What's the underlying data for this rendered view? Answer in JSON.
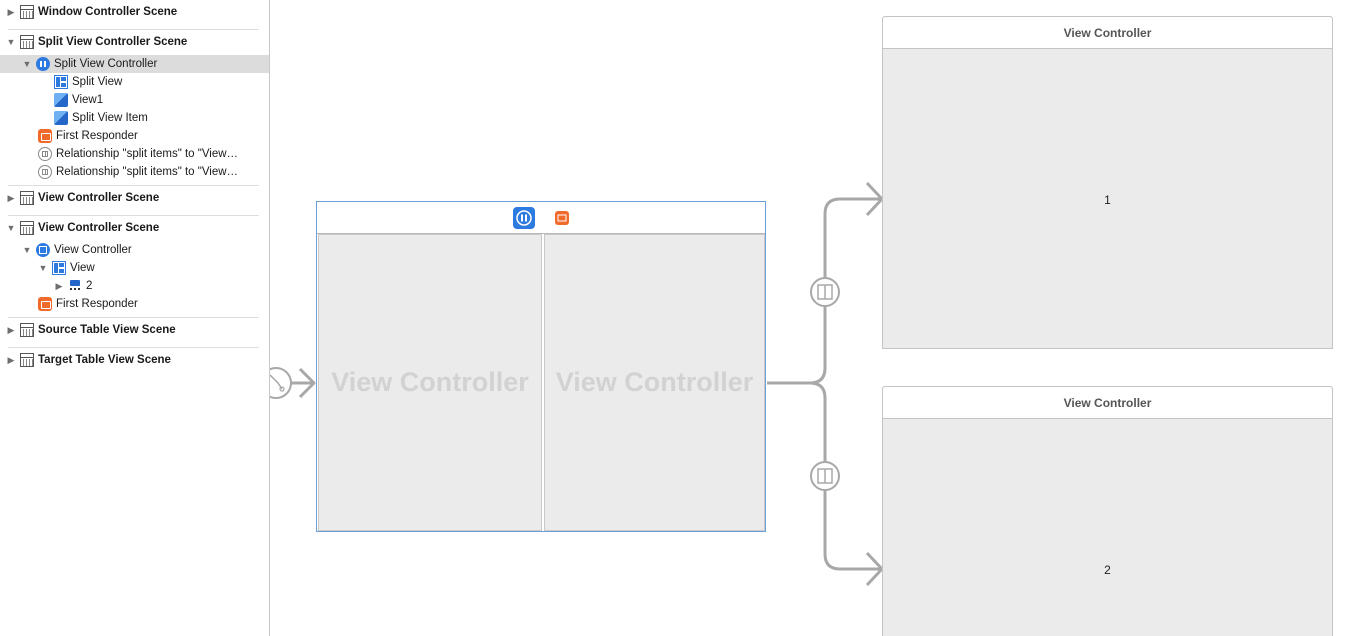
{
  "outline": {
    "rows": [
      {
        "label": "Window Controller Scene"
      },
      {
        "label": "Split View Controller Scene"
      },
      {
        "label": "Split View Controller"
      },
      {
        "label": "Split View"
      },
      {
        "label": "View1"
      },
      {
        "label": "Split View Item"
      },
      {
        "label": "First Responder"
      },
      {
        "label": "Relationship \"split items\" to \"View…"
      },
      {
        "label": "Relationship \"split items\" to \"View…"
      },
      {
        "label": "View Controller Scene"
      },
      {
        "label": "View Controller Scene"
      },
      {
        "label": "View Controller"
      },
      {
        "label": "View"
      },
      {
        "label": "2"
      },
      {
        "label": "First Responder"
      },
      {
        "label": "Source Table View Scene"
      },
      {
        "label": "Target Table View Scene"
      }
    ]
  },
  "canvas": {
    "split_controller": {
      "left_pane_title": "View Controller",
      "right_pane_title": "View Controller"
    },
    "view_controller_1": {
      "title": "View Controller",
      "content": "1"
    },
    "view_controller_2": {
      "title": "View Controller",
      "content": "2"
    }
  },
  "colors": {
    "accent": "#2d7be0",
    "first_responder": "#f06a2b",
    "segue_line": "#a8a8a8",
    "selection": "#dcdcdc"
  },
  "icons": {
    "scene": "scene-icon",
    "split_view_controller": "split-view-controller-icon",
    "view_controller": "view-controller-icon",
    "split_view": "split-view-icon",
    "view": "cube-icon",
    "first_responder": "first-responder-icon",
    "relationship": "relationship-icon"
  }
}
